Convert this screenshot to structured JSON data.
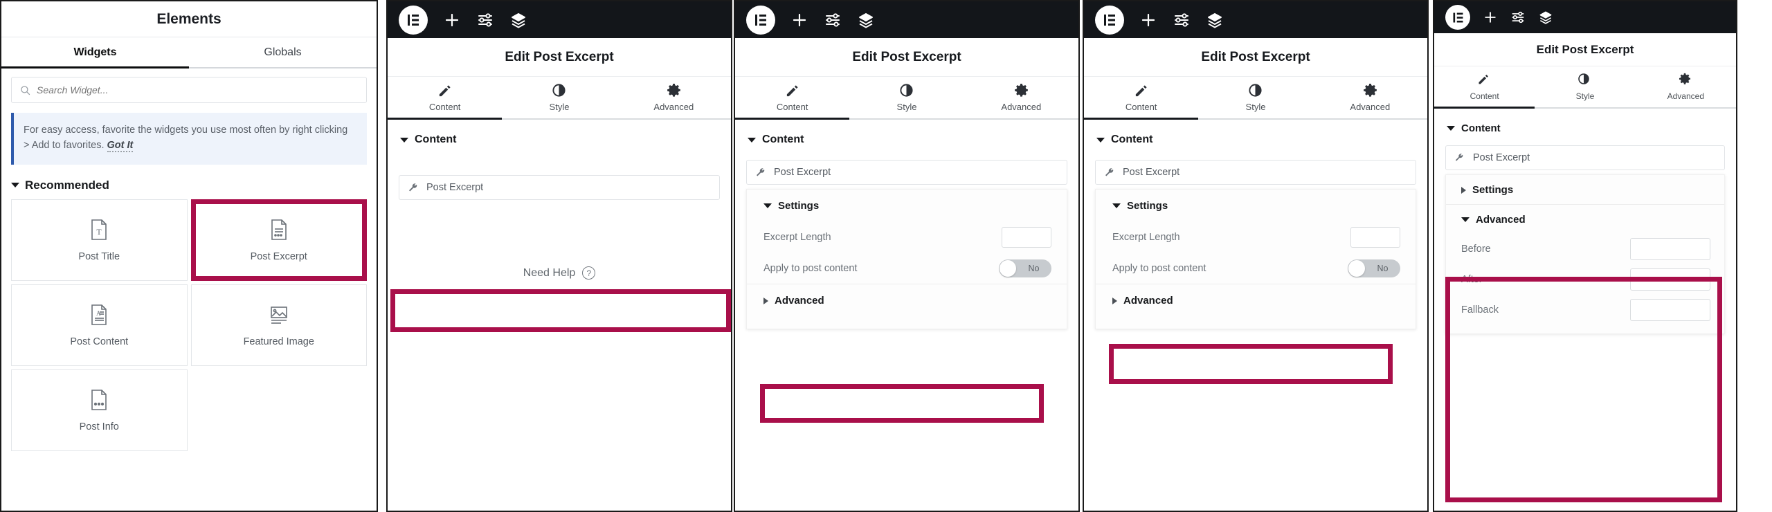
{
  "accent_color": "#a90f4a",
  "panel_elements": {
    "title": "Elements",
    "tabs": [
      {
        "label": "Widgets",
        "active": true
      },
      {
        "label": "Globals",
        "active": false
      }
    ],
    "search": {
      "placeholder": "Search Widget...",
      "value": "",
      "icon": "search-icon"
    },
    "notice": {
      "text": "For easy access, favorite the widgets you use most often by right clicking > Add to favorites.",
      "cta": "Got It"
    },
    "section": {
      "label": "Recommended",
      "expanded": true
    },
    "widgets": [
      {
        "label": "Post Title",
        "icon": "post-title-icon",
        "highlighted": false
      },
      {
        "label": "Post Excerpt",
        "icon": "post-excerpt-icon",
        "highlighted": true
      },
      {
        "label": "Post Content",
        "icon": "post-content-icon",
        "highlighted": false
      },
      {
        "label": "Featured Image",
        "icon": "featured-image-icon",
        "highlighted": false
      },
      {
        "label": "Post Info",
        "icon": "post-info-icon",
        "highlighted": false
      }
    ]
  },
  "editor": {
    "toolbar": {
      "logo": "elementor-logo-icon",
      "icons": [
        "plus-icon",
        "sliders-icon",
        "layers-icon"
      ]
    },
    "title": "Edit Post Excerpt",
    "tabs": [
      {
        "label": "Content",
        "icon": "pencil-icon",
        "active": true
      },
      {
        "label": "Style",
        "icon": "contrast-icon",
        "active": false
      },
      {
        "label": "Advanced",
        "icon": "gear-icon",
        "active": false
      }
    ],
    "content_section": {
      "label": "Content",
      "expanded": true
    },
    "widget_field": {
      "label": "Post Excerpt",
      "icon": "wrench-icon"
    },
    "settings_section": {
      "label": "Settings"
    },
    "advanced_section": {
      "label": "Advanced"
    },
    "excerpt_length": {
      "label": "Excerpt Length",
      "value": ""
    },
    "apply_to_post_content": {
      "label": "Apply to post content",
      "state": "No"
    },
    "before": {
      "label": "Before",
      "value": ""
    },
    "after": {
      "label": "After",
      "value": ""
    },
    "fallback": {
      "label": "Fallback",
      "value": ""
    },
    "need_help": {
      "label": "Need Help",
      "icon": "question-circle-icon"
    }
  }
}
